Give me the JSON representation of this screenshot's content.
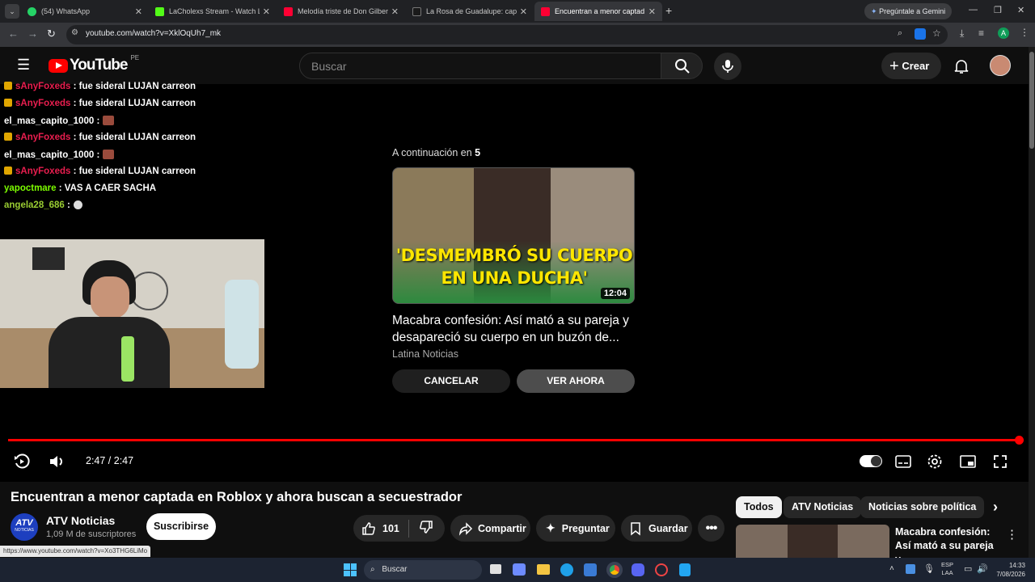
{
  "browser": {
    "tabs": [
      {
        "title": "(54) WhatsApp",
        "color": "#25d366"
      },
      {
        "title": "LaCholexs Stream - Watch Live",
        "color": "#53fc18"
      },
      {
        "title": "Melodía triste de Don Gilberto",
        "color": "#ff0033"
      },
      {
        "title": "La Rosa de Guadalupe: capítulo",
        "color": "#1a1a1a"
      },
      {
        "title": "Encuentran a menor captad",
        "color": "#ff0033"
      }
    ],
    "gemini_label": "Pregúntale a Gemini",
    "url": "youtube.com/watch?v=XklOqUh7_mk",
    "profile_letter": "A"
  },
  "youtube": {
    "logo_text": "YouTube",
    "region": "PE",
    "search_placeholder": "Buscar",
    "create_label": "Crear"
  },
  "chat": [
    {
      "user": "sAnyFoxeds",
      "user_color": "#e91e4f",
      "badge": true,
      "message": " : fue sideral LUJAN carreon",
      "emote": false
    },
    {
      "user": "sAnyFoxeds",
      "user_color": "#e91e4f",
      "badge": true,
      "message": " : fue sideral LUJAN carreon",
      "emote": false
    },
    {
      "user": "el_mas_capito_1000",
      "user_color": "#ffffff",
      "badge": false,
      "message": " :",
      "emote": true
    },
    {
      "user": "sAnyFoxeds",
      "user_color": "#e91e4f",
      "badge": true,
      "message": " : fue sideral LUJAN carreon",
      "emote": false
    },
    {
      "user": "el_mas_capito_1000",
      "user_color": "#ffffff",
      "badge": false,
      "message": " :",
      "emote": true
    },
    {
      "user": "sAnyFoxeds",
      "user_color": "#e91e4f",
      "badge": true,
      "message": " : fue sideral LUJAN carreon",
      "emote": false
    },
    {
      "user": "yapoctmare",
      "user_color": "#7cfc00",
      "badge": false,
      "message": " : VAS A CAER SACHA",
      "emote": false
    },
    {
      "user": "angela28_686",
      "user_color": "#9acd32",
      "badge": false,
      "message": " :",
      "emote": true
    }
  ],
  "upnext": {
    "prefix": "A continuación en ",
    "countdown": "5",
    "thumb_text_line1": "'DESMEMBRÓ SU CUERPO",
    "thumb_text_line2": "EN UNA DUCHA'",
    "duration": "12:04",
    "title": "Macabra confesión: Así mató a su pareja y desapareció su cuerpo en un buzón de...",
    "channel": "Latina Noticias",
    "cancel_label": "CANCELAR",
    "watch_label": "VER AHORA"
  },
  "player": {
    "time": "2:47 / 2:47",
    "progress": 1.0
  },
  "video": {
    "title": "Encuentran a menor captada en Roblox y ahora buscan a secuestrador",
    "channel": "ATV Noticias",
    "channel_logo": "ATV",
    "channel_logo_sub": "NOTICIAS",
    "subscribers": "1,09 M de suscriptores",
    "subscribe_label": "Suscribirse",
    "likes": "101",
    "share_label": "Compartir",
    "ask_label": "Preguntar",
    "save_label": "Guardar"
  },
  "chips": [
    "Todos",
    "ATV Noticias",
    "Noticias sobre política"
  ],
  "side_video": {
    "title": "Macabra confesión: Así mató a su pareja y ..."
  },
  "status_url": "https://www.youtube.com/watch?v=Xo3THG6LiMo",
  "taskbar": {
    "search_label": "Buscar",
    "lang_line1": "ESP",
    "lang_line2": "LAA",
    "time": "14:33",
    "date": "7/08/2026"
  }
}
